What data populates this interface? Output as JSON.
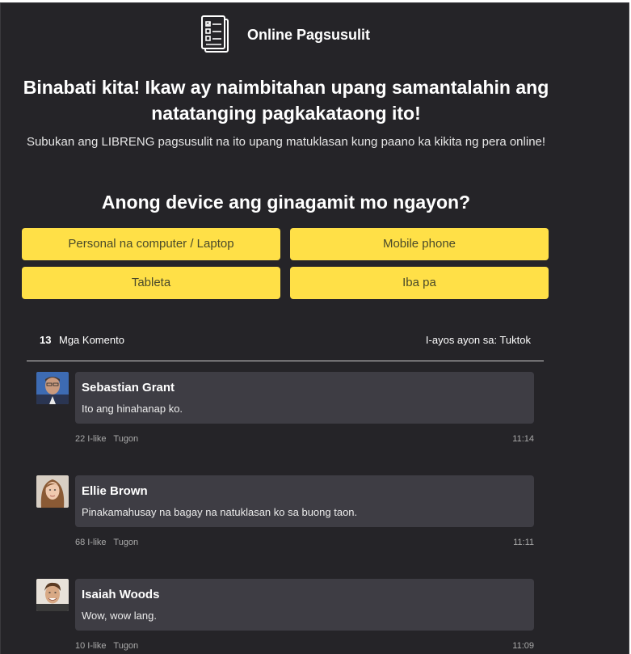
{
  "header": {
    "brand": "Online Pagsusulit",
    "logo_icon": "survey-checklist-icon"
  },
  "hero": {
    "headline": "Binabati kita! Ikaw ay naimbitahan upang samantalahin ang natatanging pagkakataong ito!",
    "subtext": "Subukan ang LIBRENG pagsusulit na ito upang matuklasan kung paano ka kikita ng pera online!"
  },
  "question": {
    "text": "Anong device ang ginagamit mo ngayon?",
    "options": [
      "Personal na computer / Laptop",
      "Mobile phone",
      "Tableta",
      "Iba pa"
    ]
  },
  "comments": {
    "count": "13",
    "count_label": "Mga Komento",
    "sort_label": "I-ayos ayon sa: Tuktok",
    "items": [
      {
        "name": "Sebastian Grant",
        "text": "Ito ang hinahanap ko.",
        "likes": "22 I-like",
        "reply": "Tugon",
        "time": "11:14"
      },
      {
        "name": "Ellie Brown",
        "text": "Pinakamahusay na bagay na natuklasan ko sa buong taon.",
        "likes": "68 I-like",
        "reply": "Tugon",
        "time": "11:11"
      },
      {
        "name": "Isaiah Woods",
        "text": "Wow, wow lang.",
        "likes": "10 I-like",
        "reply": "Tugon",
        "time": "11:09"
      }
    ]
  },
  "colors": {
    "background": "#252428",
    "accent_button": "#ffe047",
    "comment_bubble": "#3e3d44"
  }
}
